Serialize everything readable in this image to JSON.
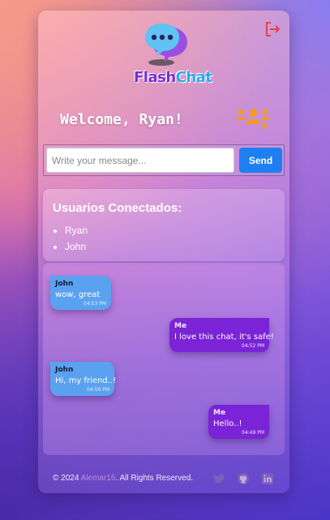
{
  "header": {
    "brand_part1": "Flash",
    "brand_part2": "Chat",
    "welcome": "Welcome, Ryan!"
  },
  "composer": {
    "placeholder": "Write your message...",
    "send_label": "Send"
  },
  "users_panel": {
    "title": "Usuarios Conectados:",
    "users": [
      "Ryan",
      "John"
    ]
  },
  "messages": [
    {
      "author": "John",
      "text": "wow, great",
      "time": "04:53 PM",
      "side": "other"
    },
    {
      "author": "Me",
      "text": "I love this chat, it's safe!",
      "time": "04:52 PM",
      "side": "me"
    },
    {
      "author": "John",
      "text": "Hi, my friend..!",
      "time": "04:50 PM",
      "side": "other"
    },
    {
      "author": "Me",
      "text": "Hello..!",
      "time": "04:49 PM",
      "side": "me"
    }
  ],
  "footer": {
    "copyright": "© 2024 ",
    "author": "Alemar16",
    "rights": ". All Rights Reserved."
  },
  "icons": {
    "logout": "logout-icon",
    "logo": "chat-bubble-icon",
    "users": "add-users-icon",
    "twitter": "twitter-icon",
    "github": "github-icon",
    "linkedin": "linkedin-icon"
  },
  "colors": {
    "send": "#1e7ff0",
    "bubble_other": "#5aa2f0",
    "bubble_me": "#7b23d6",
    "logout": "#e5424d",
    "users_icon": "#f39a24"
  }
}
